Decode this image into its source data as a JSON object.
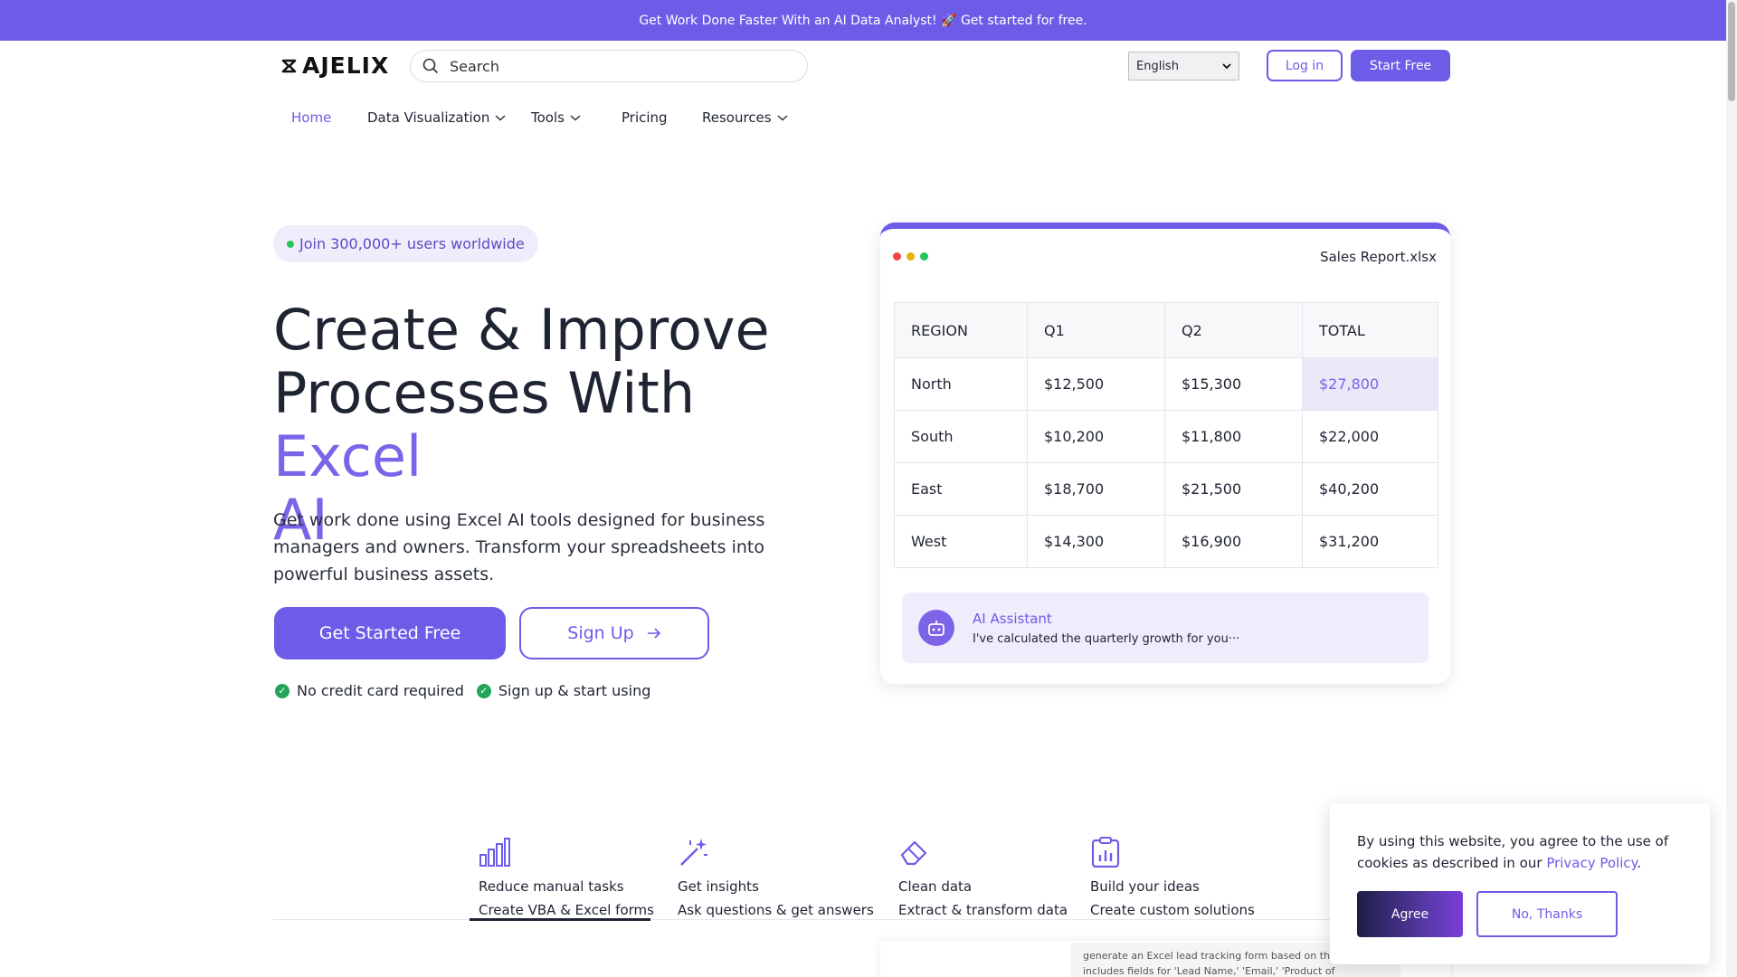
{
  "promo": {
    "text": "Get Work Done Faster With an AI Data Analyst! 🚀 Get started for free."
  },
  "header": {
    "logo": "AJELIX",
    "logo_icon": "ajelix-logo-mark",
    "search_placeholder": "Search",
    "search_icon": "search-icon",
    "language": "English",
    "login_label": "Log in",
    "start_label": "Start Free"
  },
  "nav": {
    "home": "Home",
    "data_viz": "Data Visualization",
    "tools": "Tools",
    "pricing": "Pricing",
    "resources": "Resources"
  },
  "hero": {
    "badge": "Join 300,000+ users worldwide",
    "title_line1": "Create & Improve",
    "title_line2": "Processes With",
    "title_accent_1": "Excel",
    "title_accent_2": "AI",
    "subtitle": "Get work done using Excel AI tools designed for business managers and owners. Transform your spreadsheets into powerful business assets.",
    "cta_primary": "Get Started Free",
    "cta_secondary": "Sign Up",
    "check_1": "No credit card required",
    "check_2": "Sign up & start using"
  },
  "sheet": {
    "file_name": "Sales Report.xlsx",
    "columns": [
      "REGION",
      "Q1",
      "Q2",
      "TOTAL"
    ],
    "rows": [
      [
        "North",
        "$12,500",
        "$15,300",
        "$27,800"
      ],
      [
        "South",
        "$10,200",
        "$11,800",
        "$22,000"
      ],
      [
        "East",
        "$18,700",
        "$21,500",
        "$40,200"
      ],
      [
        "West",
        "$14,300",
        "$16,900",
        "$31,200"
      ]
    ],
    "ai_title": "AI Assistant",
    "ai_message": "I've calculated the quarterly growth for you···",
    "window_dot_colors": [
      "#ef4444",
      "#eab308",
      "#22c55e"
    ]
  },
  "features": [
    {
      "icon": "bar-chart-icon",
      "title": "Reduce manual tasks",
      "subtitle": "Create VBA & Excel forms"
    },
    {
      "icon": "magic-wand-icon",
      "title": "Get insights",
      "subtitle": "Ask questions & get answers"
    },
    {
      "icon": "eraser-icon",
      "title": "Clean data",
      "subtitle": "Extract & transform data"
    },
    {
      "icon": "clipboard-chart-icon",
      "title": "Build your ideas",
      "subtitle": "Create custom solutions"
    }
  ],
  "preview_prompt": "generate an Excel lead tracking form based on the data that includes fields for 'Lead Name,' 'Email,' 'Product of",
  "cookie": {
    "text": "By using this website, you agree to the use of cookies as described in our",
    "link": "Privacy Policy",
    "period": ".",
    "agree": "Agree",
    "decline": "No, Thanks"
  },
  "colors": {
    "accent": "#6c5ce7",
    "accent_light": "#7c63e8",
    "success": "#22a559"
  }
}
